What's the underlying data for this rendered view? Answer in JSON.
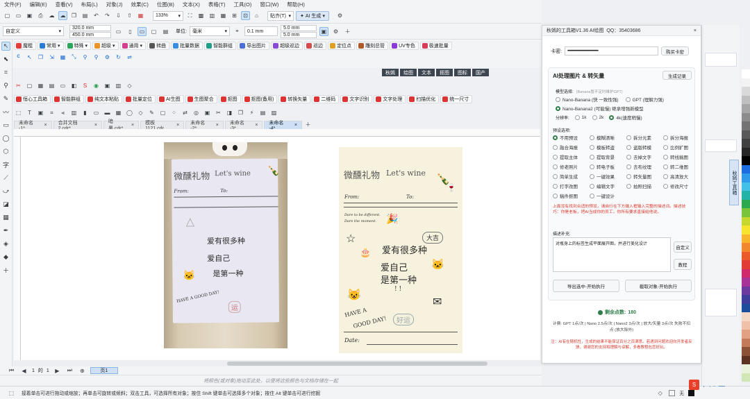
{
  "menu": [
    "文件(F)",
    "编辑(E)",
    "查看(V)",
    "布局(L)",
    "对象(J)",
    "效果(C)",
    "位图(B)",
    "文本(X)",
    "表格(T)",
    "工具(O)",
    "窗口(W)",
    "帮助(H)"
  ],
  "toolbar": {
    "zoom": "133%",
    "snap_label": "贴齐(T)",
    "ai_label": "AI 生成"
  },
  "propbar": {
    "page_preset": "自定义",
    "width": "320.0 mm",
    "height": "450.0 mm",
    "unit_label": "单位:",
    "unit": "毫米",
    "nudge": "0.1 mm",
    "dup_x": "5.0 mm",
    "dup_y": "5.0 mm"
  },
  "plugins_row1": [
    "魔棍",
    "常用",
    "特殊",
    "超级",
    "通用",
    "转曲",
    "批量数据",
    "智能群组",
    "导出图片",
    "超级巡边",
    "巡边",
    "定位点",
    "雕刻总管",
    "UV专色",
    "极速批量"
  ],
  "nav_tabs": [
    "秋嫣",
    "绘图",
    "文本",
    "抠图",
    "图标",
    "国产"
  ],
  "plugins_row2": [
    "恒心工具箱",
    "智能群组",
    "纯文本粘贴",
    "批量定位",
    "AI生图",
    "生图聚合",
    "抠图",
    "抠图(备用)",
    "转换矢量",
    "二维码",
    "文字识别",
    "文字处理",
    "扫描优化",
    "统一尺寸",
    "更多"
  ],
  "doc_tabs": [
    "未命名 -1*",
    "合并文档 2.cdr*",
    "暗黑.cdr*",
    "模板1121.cdr",
    "未命名 -2*",
    "未命名 -3*",
    "未命名 -4*"
  ],
  "pagenav": {
    "counter": "1",
    "of": "的",
    "total": "1",
    "page": "页1"
  },
  "hint": "将颜色(或对象)拖动至此处，以便将这些颜色与文档存储在一起",
  "status": "接着单击可进行拖动或缩放；再单击可旋转或倾斜；双击工具，可选择所有对象；按住 Shift 键单击可选择多个对象；按住 Alt 键单击可进行挖掘",
  "status_fill": "无",
  "photo": {
    "title": "微醺礼物",
    "title_en": "Let's wine",
    "from": "From:",
    "to": "To:",
    "line1": "爱有很多种",
    "line2": "爱自己",
    "line3": "是第一种",
    "haveday": "HAVE A GOOD DAY!"
  },
  "design": {
    "title": "微醺礼物",
    "title_en": "Let's wine",
    "from": "From:",
    "to": "To:",
    "dare1": "Dare to be different.",
    "dare2": "Dare the moment.",
    "bubble": "大吉",
    "line1": "爱有很多种",
    "line2": "爱自己",
    "line3": "是第一种",
    "excl": "! !",
    "haveday1": "HAVE A",
    "haveday2": "GOOD DAY!",
    "luck": "好运",
    "date": "Date:"
  },
  "panel": {
    "title": "秋嫣的工具箱V1.36 AI绘图",
    "qq": "QQ：35403686",
    "key_label": "卡密:",
    "key_value": "••••••••••••••••••••••••••••••••••••••••",
    "buy": "购买卡密",
    "section_title": "AI处理图片 & 转矢量",
    "records": "生成记录",
    "model_label": "模型选择:",
    "model_hint": "(Banana暂不定时维护GPT)",
    "models": [
      {
        "name": "Nano-Banana (快 一致性强)",
        "on": false
      },
      {
        "name": "GPT (理解力强)",
        "on": false
      },
      {
        "name": "Nano-Banana2 (可能慢) 继承增强新模型",
        "on": true
      }
    ],
    "res_label": "分辨率:",
    "resolutions": [
      {
        "name": "1k",
        "on": false
      },
      {
        "name": "2k",
        "on": false
      },
      {
        "name": "4k(速度稍慢)",
        "on": true
      }
    ],
    "preset_label": "预设选项:",
    "presets": [
      {
        "name": "不用预设",
        "on": true
      },
      {
        "name": "模糊清晰",
        "on": false
      },
      {
        "name": "拆分元素",
        "on": false
      },
      {
        "name": "拆分海报",
        "on": false
      },
      {
        "name": "融合海报",
        "on": false
      },
      {
        "name": "模板转盗",
        "on": false
      },
      {
        "name": "盗版转模",
        "on": false
      },
      {
        "name": "比例扩图",
        "on": false
      },
      {
        "name": "提取主体",
        "on": false
      },
      {
        "name": "提取背景",
        "on": false
      },
      {
        "name": "去掉文字",
        "on": false
      },
      {
        "name": "转线稿图",
        "on": false
      },
      {
        "name": "修老照片",
        "on": false
      },
      {
        "name": "转电子板",
        "on": false
      },
      {
        "name": "去布纹理",
        "on": false
      },
      {
        "name": "转二维图",
        "on": false
      },
      {
        "name": "简单生成",
        "on": false
      },
      {
        "name": "一键效果",
        "on": false
      },
      {
        "name": "转矢量图",
        "on": false
      },
      {
        "name": "高清放大",
        "on": false
      },
      {
        "name": "打字改图",
        "on": false
      },
      {
        "name": "编辑文字",
        "on": false
      },
      {
        "name": "拍照扫描",
        "on": false
      },
      {
        "name": "修改尺寸",
        "on": false
      },
      {
        "name": "稿件抠图",
        "on": false
      },
      {
        "name": "一键设计",
        "on": false
      }
    ],
    "warning": "上面没有找到合适的预设，请自行在下方输入框输入完整的描述词。描述技巧：你是老板，把AI当成你的员工，你所有要求直接给他说。",
    "desc_label": "描述补充:",
    "desc_value": "对瓶身上的标签生成平面展开图，并进行美化设计",
    "custom": "自定义",
    "tutorial": "教程",
    "export_btn": "导出选中-开始执行",
    "crop_btn": "截取对象-开始执行",
    "points_label": "剩余点数:",
    "points": "180",
    "pricing": "计费: GPT 1点/次 | Nano 2.5点/次 | Nano2 3点/次 | 放大/矢量 3点/次 失败不扣点 (放大除外)",
    "note": "注：AI有在随机性，生成的结果不能保证百分之百满意。若遇到问题欢迎向开发者反馈，谢谢您的支持和理解与谅解，多看教程包您好玩。"
  },
  "side_tab": "秋嫣工具箱",
  "palette": [
    "#ffffff",
    "#f2f2f2",
    "#d9d9d9",
    "#bfbfbf",
    "#a6a6a6",
    "#8c8c8c",
    "#737373",
    "#595959",
    "#404040",
    "#262626",
    "#000000",
    "#1d6ce0",
    "#2f9be8",
    "#42c0e8",
    "#21b3a8",
    "#2ca84f",
    "#79c43a",
    "#c6d82d",
    "#f7e42c",
    "#f7b52b",
    "#f2882e",
    "#ea5a2b",
    "#e13a37",
    "#d12a6a",
    "#a83498",
    "#6d3aa0",
    "#3e3f9a",
    "#1b4f9c",
    "#f5d7c6",
    "#f0c0a8",
    "#e2a183",
    "#c27a5a",
    "#8c5236",
    "#5b3320",
    "#e9f3dc",
    "#d0e6b7"
  ]
}
